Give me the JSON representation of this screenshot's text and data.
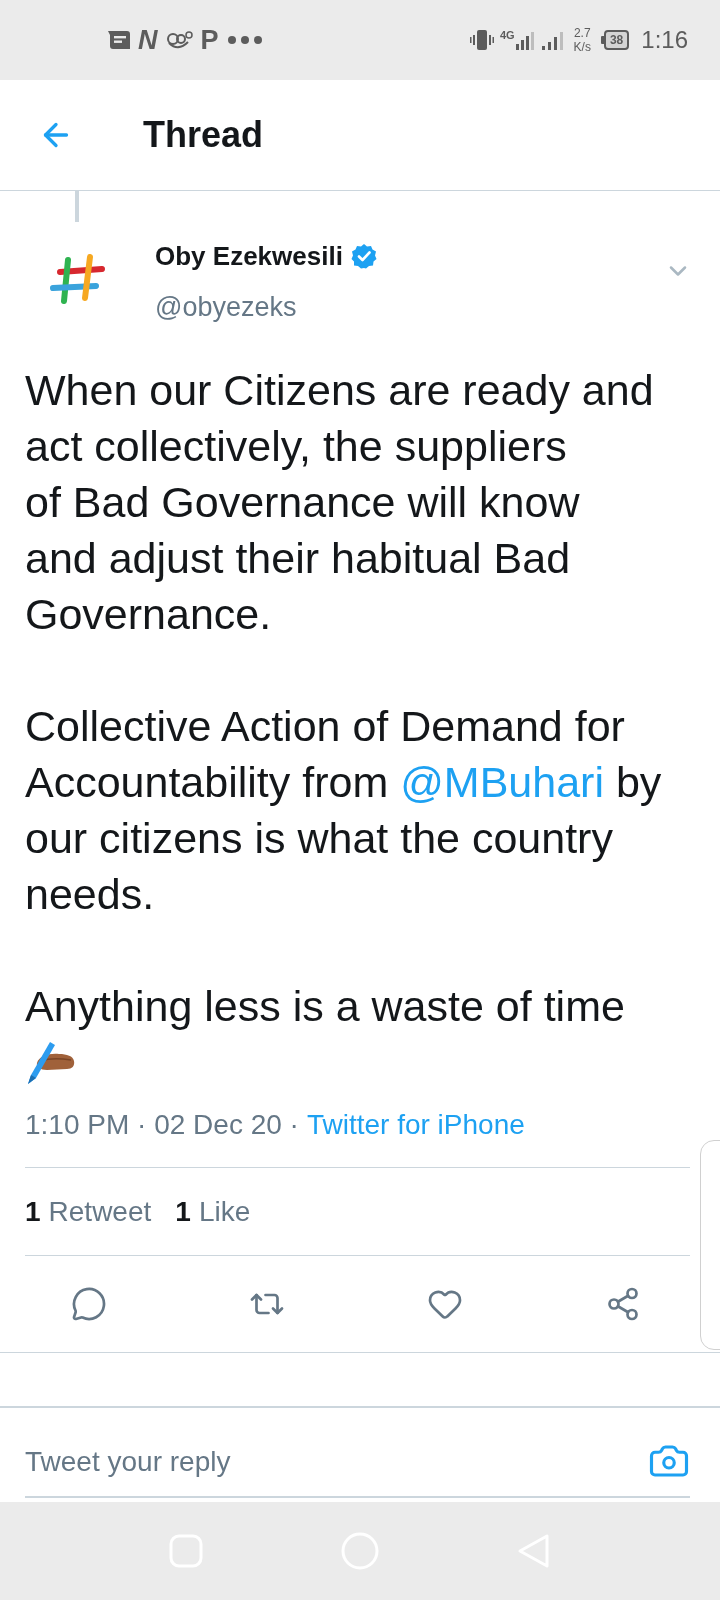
{
  "status_bar": {
    "app_icons": [
      {
        "kind": "message"
      },
      {
        "kind": "slanted_letter",
        "glyph": "N"
      },
      {
        "kind": "logo"
      },
      {
        "kind": "letter",
        "glyph": "P"
      },
      {
        "kind": "more"
      }
    ],
    "network_type": "4G",
    "data_speed": "2.7",
    "data_unit": "K/s",
    "battery": "38",
    "time": "1:16"
  },
  "header": {
    "title": "Thread"
  },
  "tweet": {
    "author": {
      "name": "Oby Ezekwesili",
      "verified": true,
      "handle": "@obyezeks"
    },
    "paragraphs": [
      [
        {
          "kind": "text",
          "text": "When our Citizens are ready and\nact collectively, the suppliers\nof Bad Governance will know\nand adjust their habitual Bad\nGovernance."
        }
      ],
      [
        {
          "kind": "text",
          "text": "Collective Action of Demand for\nAccountability from "
        },
        {
          "kind": "mention",
          "text": "@MBuhari"
        },
        {
          "kind": "text",
          "text": " by\nour citizens is what the country\nneeds."
        }
      ],
      [
        {
          "kind": "text",
          "text": "Anything less is a waste of time"
        }
      ]
    ],
    "timestamp": "1:10 PM · 02 Dec 20 ·",
    "source": "Twitter for iPhone",
    "stats": [
      {
        "count": "1",
        "label": "Retweet"
      },
      {
        "count": "1",
        "label": "Like"
      }
    ],
    "actions": [
      {
        "kind": "reply"
      },
      {
        "kind": "retweet"
      },
      {
        "kind": "like"
      },
      {
        "kind": "share"
      }
    ]
  },
  "reply_box": {
    "placeholder": "Tweet your reply"
  }
}
